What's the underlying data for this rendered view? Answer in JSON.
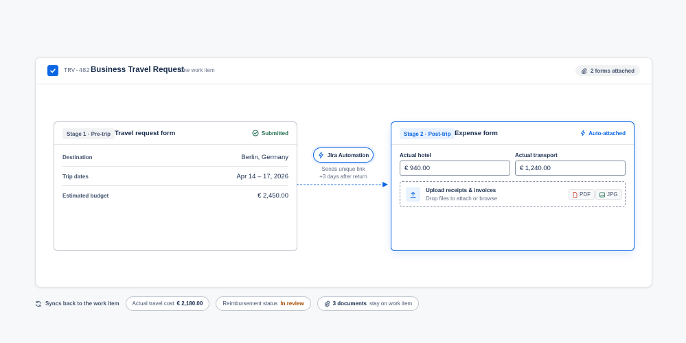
{
  "header": {
    "key": "TRV-482",
    "title": "Business Travel Request",
    "subtitle": "· one work item",
    "forms_attached": "2 forms attached"
  },
  "stage1": {
    "stage_label": "Stage 1 · Pre-trip",
    "form_title": "Travel request form",
    "status": "Submitted",
    "rows": [
      {
        "label": "Destination",
        "value": "Berlin, Germany"
      },
      {
        "label": "Trip dates",
        "value": "Apr 14 – 17, 2026"
      },
      {
        "label": "Estimated budget",
        "value": "€ 2,450.00"
      }
    ]
  },
  "automation": {
    "label": "Jira Automation",
    "note_line1": "Sends unique link",
    "note_line2": "+3 days after return"
  },
  "stage2": {
    "stage_label": "Stage 2 · Post-trip",
    "form_title": "Expense form",
    "status": "Auto-attached",
    "hotel_label": "Actual hotel",
    "hotel_value": "€ 940.00",
    "transport_label": "Actual transport",
    "transport_value": "€ 1,240.00",
    "upload_title": "Upload receipts & invoices",
    "upload_sub": "Drop files to attach or browse",
    "file_types": [
      "PDF",
      "JPG"
    ]
  },
  "footer": {
    "sync_label": "Syncs back to the work item",
    "cost_label": "Actual travel cost",
    "cost_value": "€ 2,180.00",
    "reimb_label": "Reimbursement status",
    "reimb_value": "In review",
    "docs_value": "3 documents",
    "docs_label": "stay on work item"
  },
  "colors": {
    "accent": "#0c66e4",
    "success": "#216e4e",
    "warning": "#a54800",
    "text": "#172b4d"
  }
}
